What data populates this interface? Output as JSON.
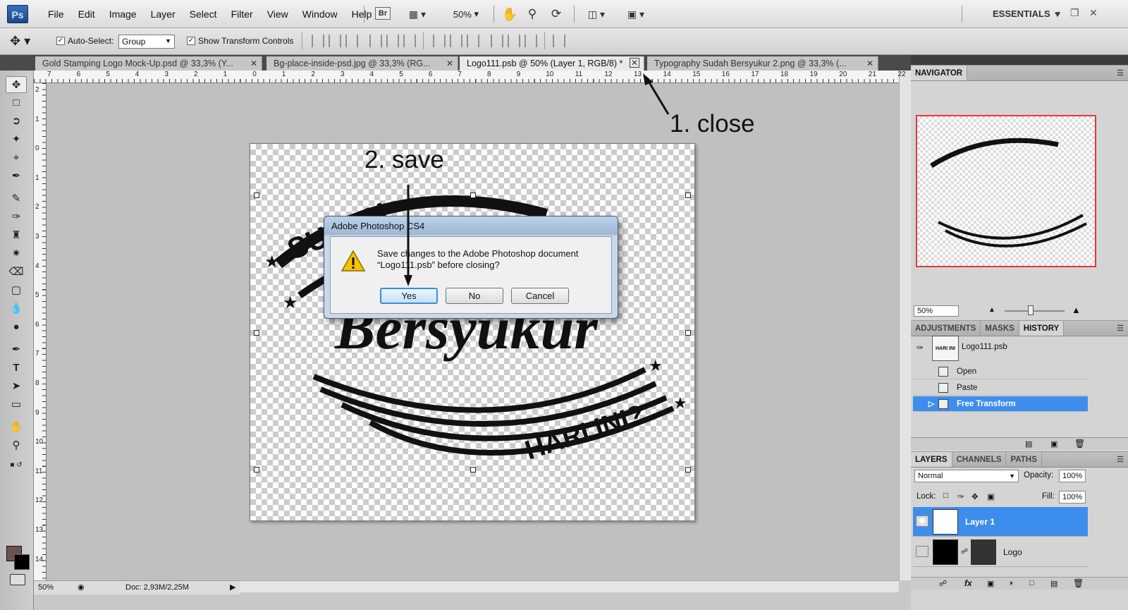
{
  "app": {
    "logo": "Ps",
    "menu": [
      "File",
      "Edit",
      "Image",
      "Layer",
      "Select",
      "Filter",
      "View",
      "Window",
      "Help"
    ],
    "bridge_label": "Br",
    "zoom": "50%",
    "workspace": "ESSENTIALS"
  },
  "options_bar": {
    "auto_select_label": "Auto-Select:",
    "auto_select_checked": true,
    "auto_select_value": "Group",
    "show_transform_label": "Show Transform Controls",
    "show_transform_checked": true
  },
  "tabs": [
    {
      "label": "Gold Stamping Logo Mock-Up.psd @ 33,3% (Y...",
      "active": false
    },
    {
      "label": "Bg-place-inside-psd.jpg @ 33,3% (RG...",
      "active": false
    },
    {
      "label": "Logo111.psb @ 50% (Layer 1, RGB/8) *",
      "active": true
    },
    {
      "label": "Typography Sudah Bersyukur 2.png @ 33,3% (...",
      "active": false
    }
  ],
  "rulers": {
    "h_labels": [
      "7",
      "6",
      "5",
      "4",
      "3",
      "2",
      "1",
      "0",
      "1",
      "2",
      "3",
      "4",
      "5",
      "6",
      "7",
      "8",
      "9",
      "10",
      "11",
      "12",
      "13",
      "14",
      "15",
      "16",
      "17",
      "18",
      "19",
      "20",
      "21",
      "22"
    ],
    "v_labels": [
      "2",
      "1",
      "0",
      "1",
      "2",
      "3",
      "4",
      "5",
      "6",
      "7",
      "8",
      "9",
      "10",
      "11",
      "12",
      "13",
      "14"
    ]
  },
  "canvas_art": {
    "line1": "SUDAH",
    "line2": "Bersyukur",
    "line3": "HARI INI?"
  },
  "status": {
    "zoom": "50%",
    "doc": "Doc: 2,93M/2,25M"
  },
  "dialog": {
    "title": "Adobe Photoshop CS4",
    "message_line1": "Save changes to the Adobe Photoshop document",
    "message_line2": "“Logo111.psb” before closing?",
    "yes": "Yes",
    "no": "No",
    "cancel": "Cancel"
  },
  "annotations": {
    "close": "1. close",
    "save": "2. save"
  },
  "navigator": {
    "title": "NAVIGATOR",
    "zoom": "50%"
  },
  "history_panel": {
    "tabs": [
      "ADJUSTMENTS",
      "MASKS",
      "HISTORY"
    ],
    "active_tab": "HISTORY",
    "snapshot_name": "Logo111.psb",
    "snapshot_thumb_text": "HARI INI",
    "states": [
      {
        "label": "Open",
        "selected": false
      },
      {
        "label": "Paste",
        "selected": false
      },
      {
        "label": "Free Transform",
        "selected": true
      }
    ]
  },
  "layers_panel": {
    "tabs": [
      "LAYERS",
      "CHANNELS",
      "PATHS"
    ],
    "active_tab": "LAYERS",
    "blend_mode": "Normal",
    "opacity_label": "Opacity:",
    "opacity": "100%",
    "lock_label": "Lock:",
    "fill_label": "Fill:",
    "fill": "100%",
    "layers": [
      {
        "name": "Layer 1",
        "selected": true,
        "visible": true
      },
      {
        "name": "Logo",
        "selected": false,
        "visible": false
      }
    ]
  },
  "colors": {
    "selection_blue": "#3d8eec",
    "foreground_swatch": "#6b5354",
    "background_swatch": "#000000"
  }
}
